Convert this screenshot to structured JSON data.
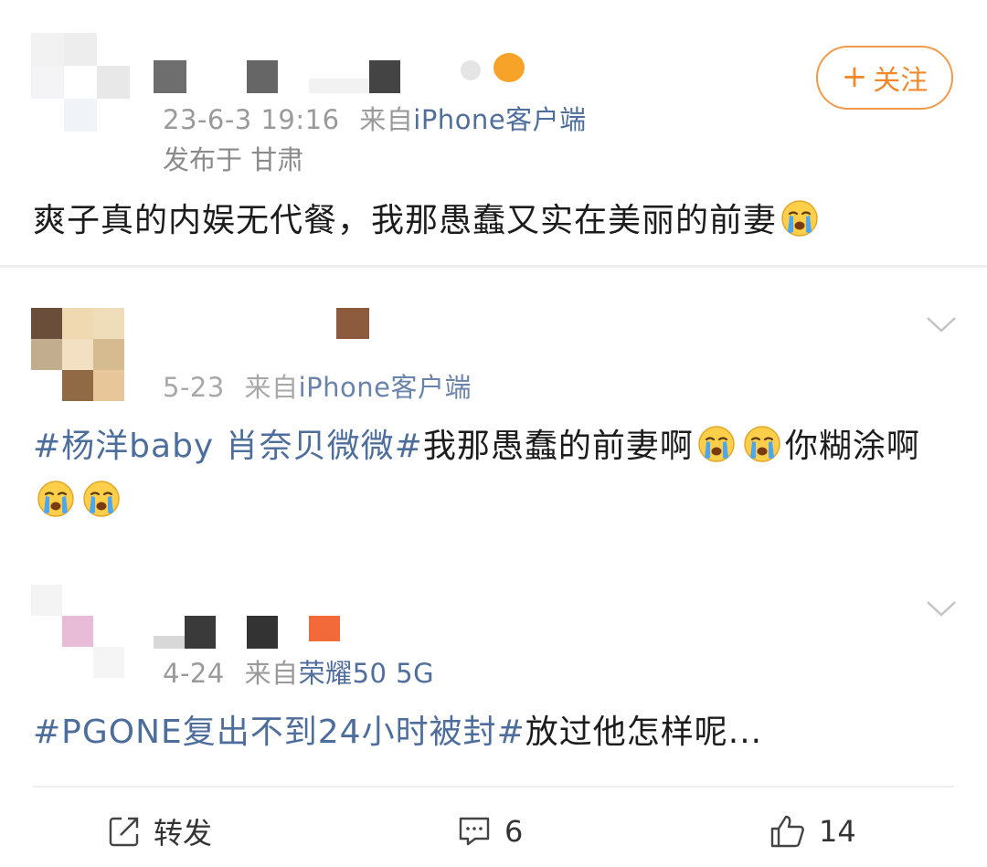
{
  "post": {
    "meta_date": "23-6-3 19:16",
    "meta_from": "来自",
    "meta_device": "iPhone客户端",
    "location": "发布于 甘肃",
    "follow_label": "关注",
    "content": "爽子真的内娱无代餐，我那愚蠢又实在美丽的前妻"
  },
  "comments": [
    {
      "meta_date": "5-23",
      "meta_from": "来自",
      "meta_device": "iPhone客户端",
      "topic": "#杨洋baby 肖奈贝微微#",
      "text_a": "我那愚蠢的前妻啊",
      "text_b": "你糊涂啊"
    },
    {
      "meta_date": "4-24",
      "meta_from": "来自",
      "meta_device": "荣耀50 5G",
      "topic": "#PGONE复出不到24小时被封#",
      "text_a": "放过他怎样呢..."
    }
  ],
  "actions": {
    "repost_label": "转发",
    "comment_count": "6",
    "like_count": "14"
  },
  "colors": {
    "accent_orange": "#f0892c",
    "link_blue": "#4d6e9c",
    "meta_gray": "#9a9a9a"
  },
  "icons": [
    "crying-emoji-icon",
    "chevron-down-icon",
    "repost-icon",
    "comment-icon",
    "like-icon"
  ]
}
